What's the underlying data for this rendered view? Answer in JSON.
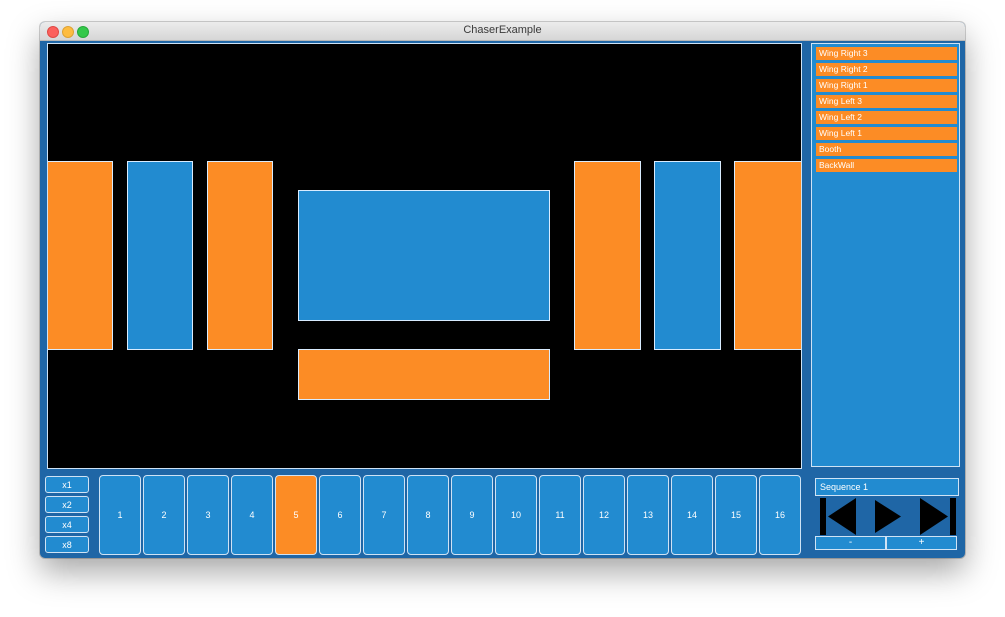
{
  "window": {
    "title": "ChaserExample"
  },
  "fixtures": {
    "wing_left_outer": "orange",
    "wing_left_mid": "blue",
    "wing_left_inner": "orange",
    "backwall": "blue",
    "booth": "orange",
    "wing_right_inner": "orange",
    "wing_right_mid": "blue",
    "wing_right_outer": "orange"
  },
  "colors": {
    "orange": "#fc8c25",
    "blue": "#228bd0",
    "frame": "#1f66a6",
    "stage": "#000000"
  },
  "fixture_list": [
    "Wing Right 3",
    "Wing Right 2",
    "Wing Right 1",
    "Wing Left 3",
    "Wing Left 2",
    "Wing Left 1",
    "Booth",
    "BackWall"
  ],
  "multipliers": [
    "x1",
    "x2",
    "x4",
    "x8"
  ],
  "steps": [
    "1",
    "2",
    "3",
    "4",
    "5",
    "6",
    "7",
    "8",
    "9",
    "10",
    "11",
    "12",
    "13",
    "14",
    "15",
    "16"
  ],
  "active_step": "5",
  "sequence": {
    "name": "Sequence 1",
    "previous_icon": "skip-back-icon",
    "play_icon": "play-icon",
    "next_icon": "skip-forward-icon",
    "minus_label": "-",
    "plus_label": "+"
  }
}
